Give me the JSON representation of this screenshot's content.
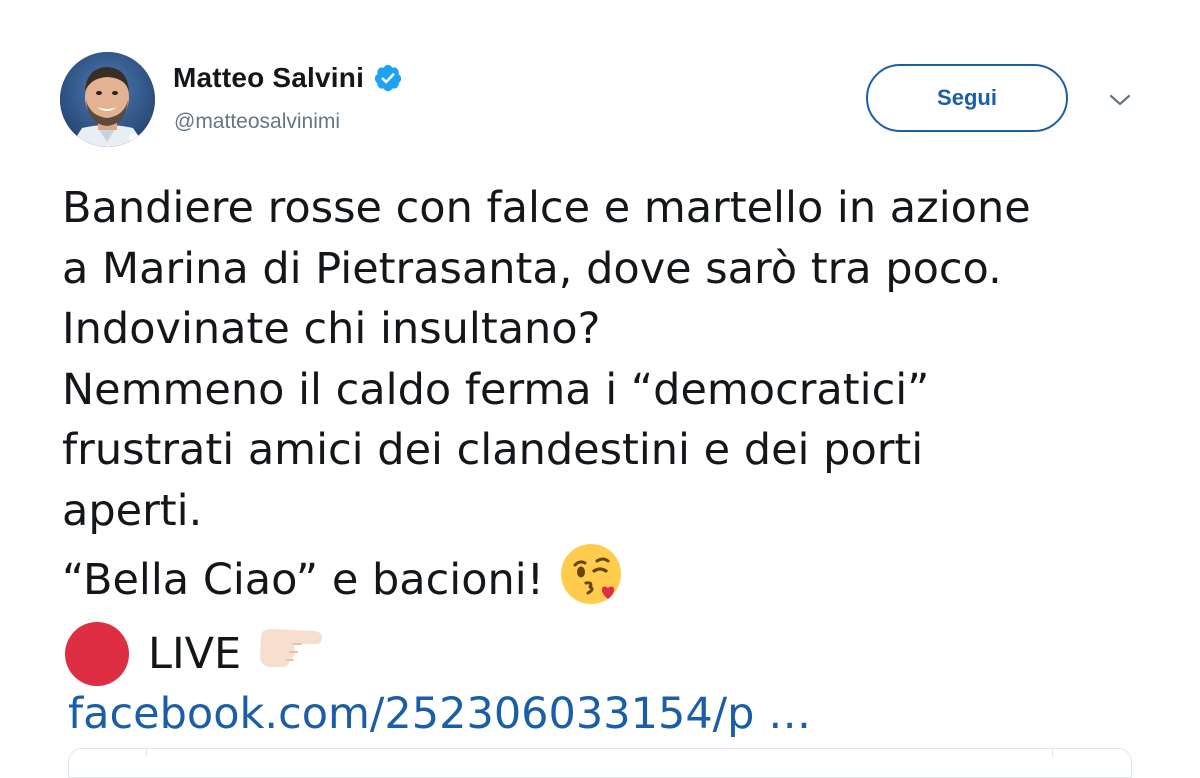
{
  "user": {
    "display_name": "Matteo Salvini",
    "handle": "@matteosalvinimi",
    "verified": true
  },
  "actions": {
    "follow_label": "Segui"
  },
  "icons": {
    "verified": "verified-badge-icon",
    "caret": "chevron-down-icon",
    "kiss_emoji": "face-blowing-kiss-icon",
    "red_circle": "red-circle-icon",
    "pointing_hand": "backhand-pointing-right-icon"
  },
  "colors": {
    "link": "#1b5ea8",
    "verified": "#1da1f2",
    "red_circle": "#dd2e44",
    "text": "#14171a",
    "muted": "#657786"
  },
  "tweet": {
    "lines": [
      "Bandiere rosse con falce e martello in azione",
      "a Marina di Pietrasanta, dove sarò tra poco.",
      "Indovinate chi insultano?",
      "Nemmeno il caldo ferma i “democratici”",
      "frustrati amici dei clandestini e dei porti",
      "aperti.",
      "“Bella Ciao” e bacioni!"
    ],
    "live_label": "LIVE",
    "link_text": "facebook.com/252306033154/p …"
  }
}
